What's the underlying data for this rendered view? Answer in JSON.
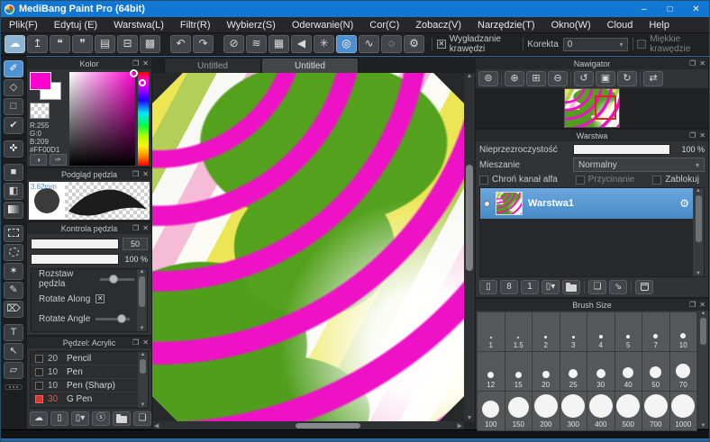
{
  "window": {
    "title": "MediBang Paint Pro (64bit)",
    "controls": [
      {
        "name": "minimize",
        "glyph": "–"
      },
      {
        "name": "maximize",
        "glyph": "□"
      },
      {
        "name": "close",
        "glyph": "✕"
      }
    ]
  },
  "menu": {
    "items": [
      "Plik(F)",
      "Edytuj (E)",
      "Warstwa(L)",
      "Filtr(R)",
      "Wybierz(S)",
      "Oderwanie(N)",
      "Cor(C)",
      "Zobacz(V)",
      "Narzędzie(T)",
      "Okno(W)",
      "Cloud",
      "Help"
    ]
  },
  "toolbar": {
    "buttons": [
      {
        "name": "cloud",
        "glyph": "☁",
        "style": "light"
      },
      {
        "name": "upload",
        "glyph": "↥"
      },
      {
        "name": "comment",
        "glyph": "❝"
      },
      {
        "name": "chat",
        "glyph": "❞"
      },
      {
        "name": "document",
        "glyph": "▤"
      },
      {
        "name": "checklist",
        "glyph": "⊟"
      },
      {
        "name": "grid-edit",
        "glyph": "▩"
      },
      {
        "sep": true
      },
      {
        "name": "undo",
        "glyph": "↶"
      },
      {
        "name": "redo",
        "glyph": "↷"
      },
      {
        "sep": true
      },
      {
        "name": "snap-off",
        "glyph": "⊘"
      },
      {
        "name": "snap-parallel",
        "glyph": "≋"
      },
      {
        "name": "snap-grid",
        "glyph": "▦"
      },
      {
        "name": "snap-vanishing",
        "glyph": "◀"
      },
      {
        "name": "snap-radial",
        "glyph": "✳"
      },
      {
        "name": "snap-concentric",
        "glyph": "◎",
        "active": true
      },
      {
        "name": "snap-curve",
        "glyph": "∿"
      },
      {
        "name": "snap-ellipse",
        "glyph": "◌"
      },
      {
        "name": "snap-settings",
        "glyph": "⚙"
      }
    ],
    "antialias_label": "Wygładzanie krawędzi",
    "antialias_checked": true,
    "correction_label": "Korekta",
    "correction_value": "0",
    "soft_edge_label": "Miękkie krawędzie",
    "soft_edge_checked": false
  },
  "tools": {
    "items": [
      {
        "name": "brush-tool",
        "glyph": "✐",
        "active": true
      },
      {
        "name": "eraser-tool",
        "glyph": "◇"
      },
      {
        "name": "shape-tool",
        "glyph": "□"
      },
      {
        "name": "polyline-tool",
        "glyph": "✔"
      },
      {
        "sep": true
      },
      {
        "name": "move-tool",
        "glyph": "✜"
      },
      {
        "sep": true
      },
      {
        "name": "fill-rect-tool",
        "glyph": "■"
      },
      {
        "name": "bucket-tool",
        "glyph": "◧"
      },
      {
        "name": "gradient-tool",
        "css": "i-grad"
      },
      {
        "sep": true
      },
      {
        "name": "select-tool",
        "css": "i-dashsq"
      },
      {
        "name": "lasso-tool",
        "css": "i-dashcirc"
      },
      {
        "name": "magic-wand-tool",
        "glyph": "✶"
      },
      {
        "name": "select-pen-tool",
        "glyph": "✎"
      },
      {
        "name": "select-eraser-tool",
        "glyph": "⌦"
      },
      {
        "sep": true
      },
      {
        "name": "text-tool",
        "glyph": "T"
      },
      {
        "name": "operation-tool",
        "glyph": "↖"
      },
      {
        "name": "frame-divide-tool",
        "glyph": "▱"
      }
    ]
  },
  "color_panel": {
    "title": "Kolor",
    "r": "R:255",
    "g": "G:0",
    "b": "B:209",
    "hex": "#FF00D1",
    "foreground_color": "#FF00D1",
    "buttons": [
      {
        "name": "color-wheel",
        "glyph": "◑"
      },
      {
        "name": "eyedropper",
        "glyph": "✑"
      }
    ]
  },
  "brush_preview": {
    "title": "Podgląd pędzla",
    "size_label": "3.62mm"
  },
  "brush_control": {
    "title": "Kontrola pędzla",
    "size_slider": {
      "percent": 74,
      "value": "50"
    },
    "opacity_slider": {
      "percent": 100,
      "value": "100 %"
    },
    "rows": [
      {
        "label": "Rozstaw pędzla",
        "control": "slider",
        "pos": 26
      },
      {
        "label": "Rotate Along",
        "control": "checkbox",
        "checked": true
      },
      {
        "label": "Rotate Angle",
        "control": "slider",
        "pos": 62
      }
    ]
  },
  "brush_list": {
    "title": "Pędzel: Acrylic",
    "items": [
      {
        "size": "20",
        "name": "Pencil",
        "selected": false
      },
      {
        "size": "10",
        "name": "Pen",
        "selected": false
      },
      {
        "size": "10",
        "name": "Pen (Sharp)",
        "selected": false
      },
      {
        "size": "30",
        "name": "G Pen",
        "selected": true
      }
    ],
    "buttons": [
      {
        "name": "upload-brush",
        "glyph": "☁"
      },
      {
        "name": "new-brush",
        "glyph": "▯"
      },
      {
        "name": "add-brush-menu",
        "glyph": "▯▾"
      },
      {
        "name": "script-brush",
        "glyph": "ⓢ"
      },
      {
        "name": "brush-folder",
        "css": "i-folder"
      },
      {
        "name": "duplicate-brush",
        "glyph": "❏"
      }
    ]
  },
  "tabs": {
    "items": [
      "Untitled",
      "Untitled"
    ],
    "active_index": 1
  },
  "navigator": {
    "title": "Nawigator",
    "buttons": [
      {
        "name": "zoom-100",
        "glyph": "⊚"
      },
      {
        "sep": true
      },
      {
        "name": "zoom-in",
        "glyph": "⊕"
      },
      {
        "name": "fit-window",
        "glyph": "⊞"
      },
      {
        "name": "zoom-out",
        "glyph": "⊖"
      },
      {
        "sep": true
      },
      {
        "name": "rotate-ccw",
        "glyph": "↺"
      },
      {
        "name": "reset-view",
        "glyph": "▣"
      },
      {
        "name": "rotate-cw",
        "glyph": "↻"
      },
      {
        "sep": true
      },
      {
        "name": "flip-view",
        "glyph": "⇄"
      }
    ]
  },
  "layers": {
    "title": "Warstwa",
    "opacity_label": "Nieprzezroczystość",
    "opacity_value": "100 %",
    "blend_label": "Mieszanie",
    "blend_value": "Normalny",
    "checkboxes": [
      {
        "label": "Chroń kanał alfa",
        "checked": false,
        "disabled": false
      },
      {
        "label": "Przycinanie",
        "checked": false,
        "disabled": true
      },
      {
        "label": "Zablokuj",
        "checked": false,
        "disabled": false
      }
    ],
    "layer_name": "Warstwa1",
    "buttons": [
      {
        "name": "new-layer",
        "glyph": "▯"
      },
      {
        "name": "new-8bit-layer",
        "glyph": "8"
      },
      {
        "name": "new-1bit-layer",
        "glyph": "1"
      },
      {
        "name": "add-layer-menu",
        "glyph": "▯▾"
      },
      {
        "name": "layer-folder",
        "css": "i-folder"
      },
      {
        "sep": true
      },
      {
        "name": "duplicate-layer",
        "glyph": "❏"
      },
      {
        "name": "merge-layer",
        "glyph": "⇘"
      },
      {
        "sep": true
      },
      {
        "name": "delete-layer",
        "css": "i-trash"
      }
    ]
  },
  "brush_size": {
    "title": "Brush Size",
    "sizes": [
      "1",
      "1.5",
      "2",
      "3",
      "4",
      "5",
      "7",
      "10",
      "12",
      "15",
      "20",
      "25",
      "30",
      "40",
      "50",
      "70",
      "100",
      "150",
      "200",
      "300",
      "400",
      "500",
      "700",
      "1000"
    ]
  },
  "colors": {
    "titlebar_blue": "#1277d3",
    "selection_blue": "#4e8fd0",
    "accent_magenta": "#FF00D1",
    "canvas_palette": [
      "#ee12c6",
      "#54a11e",
      "#e9e237",
      "#ec78af",
      "#ffffff"
    ]
  }
}
